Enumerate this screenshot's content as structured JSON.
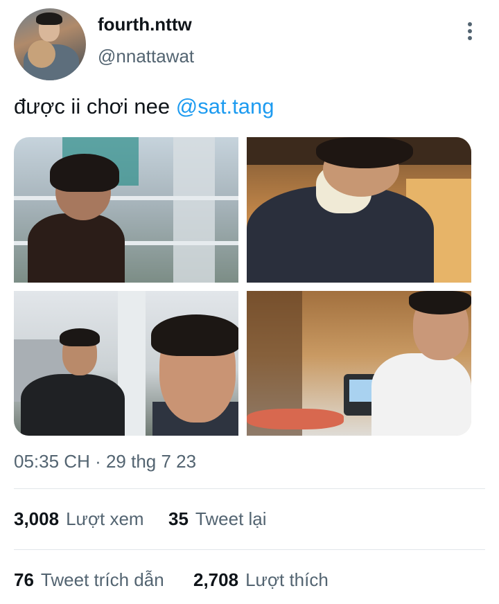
{
  "author": {
    "display_name": "fourth.nttw",
    "handle": "@nnattawat"
  },
  "tweet": {
    "text": "được ii chơi nee ",
    "mention": "@sat.tang",
    "timestamp": "05:35 CH · 29 thg 7 23"
  },
  "icons": {
    "more": "more-vertical-icon"
  },
  "stats": {
    "views": {
      "count": "3,008",
      "label": "Lượt xem"
    },
    "retweets": {
      "count": "35",
      "label": "Tweet lại"
    },
    "quotes": {
      "count": "76",
      "label": "Tweet trích dẫn"
    },
    "likes": {
      "count": "2,708",
      "label": "Lượt thích"
    }
  },
  "colors": {
    "link": "#1d9bf0",
    "secondary_text": "#536471",
    "primary_text": "#0f1419"
  }
}
